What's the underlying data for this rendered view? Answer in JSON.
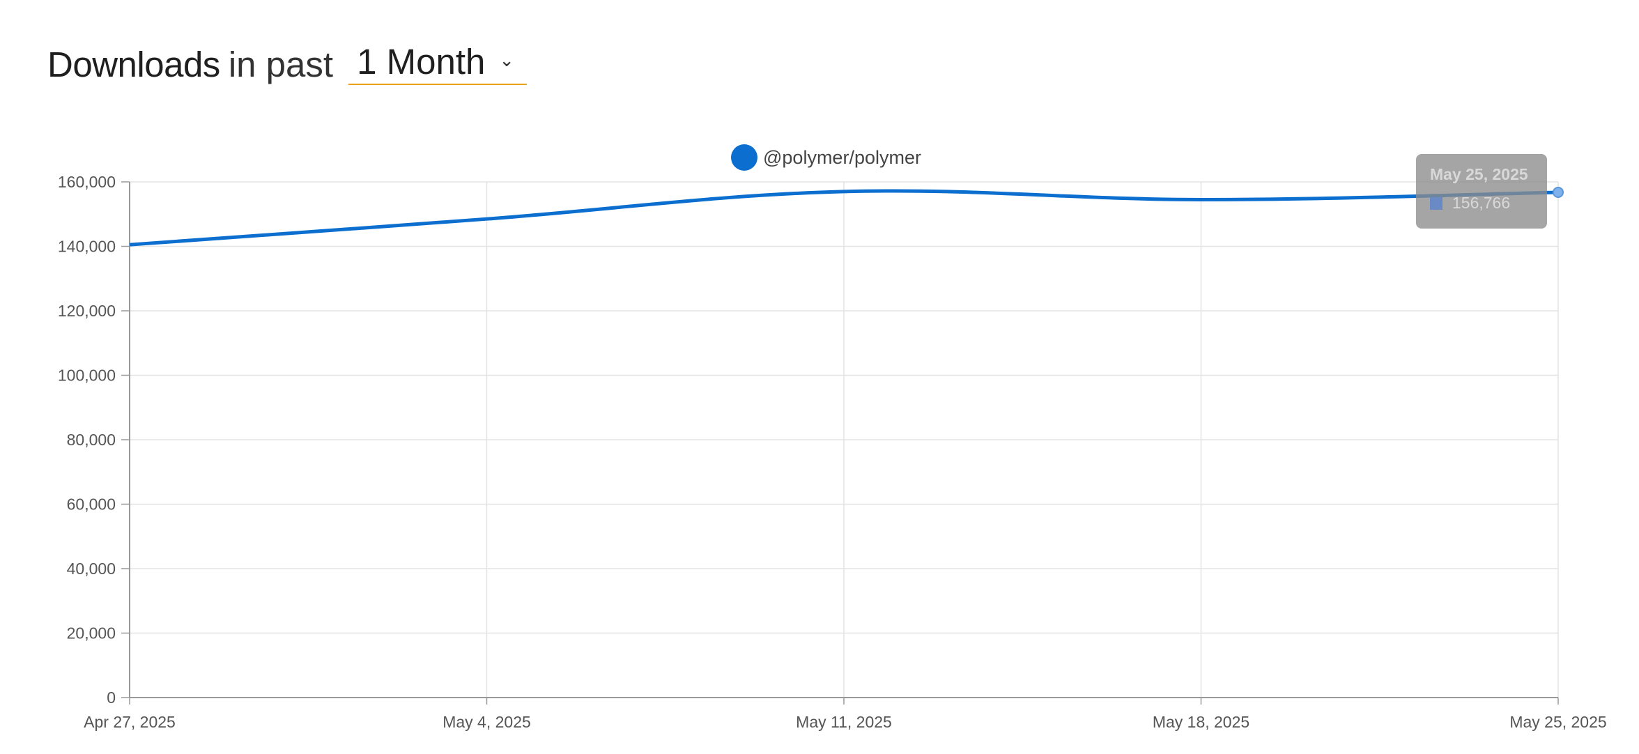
{
  "header": {
    "title_bold": "Downloads",
    "title_light": "in past",
    "period_value": "1 Month",
    "period_icon": "chevron-down-icon"
  },
  "colors": {
    "series": "#0c6fd0",
    "accent_underline": "#e8a317",
    "grid": "#e3e3e3",
    "axis": "#999999"
  },
  "chart_data": {
    "type": "line",
    "legend": {
      "position": "top-center",
      "entries": [
        "@polymer/polymer"
      ]
    },
    "grid": true,
    "x": [
      "Apr 27, 2025",
      "May 4, 2025",
      "May 11, 2025",
      "May 18, 2025",
      "May 25, 2025"
    ],
    "xticks": [
      "Apr 27, 2025",
      "May 4, 2025",
      "May 11, 2025",
      "May 18, 2025",
      "May 25, 2025"
    ],
    "yticks": [
      "0",
      "20,000",
      "40,000",
      "60,000",
      "80,000",
      "100,000",
      "120,000",
      "140,000",
      "160,000"
    ],
    "ylim": [
      0,
      160000
    ],
    "series": [
      {
        "name": "@polymer/polymer",
        "values": [
          140500,
          148500,
          157000,
          154500,
          156766
        ]
      }
    ]
  },
  "tooltip": {
    "date": "May 25, 2025",
    "value": "156,766"
  }
}
